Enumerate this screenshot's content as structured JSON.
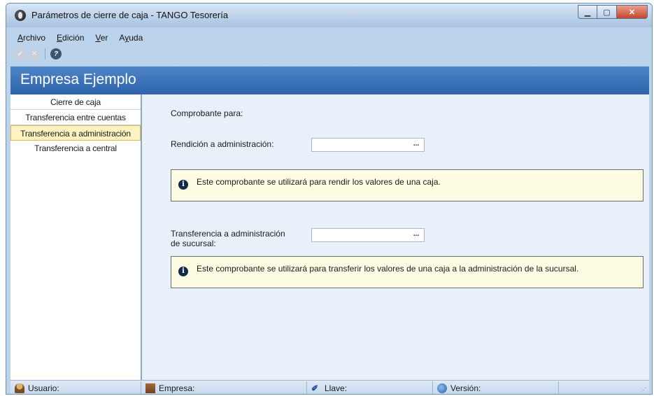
{
  "window": {
    "title": "Parámetros de cierre de caja - TANGO Tesorería"
  },
  "menu": [
    {
      "label": "Archivo",
      "u": "A",
      "rest": "rchivo"
    },
    {
      "label": "Edición",
      "u": "E",
      "rest": "dición"
    },
    {
      "label": "Ver",
      "u": "V",
      "rest": "er"
    },
    {
      "label": "Ayuda",
      "pre": "A",
      "u": "y",
      "rest": "uda"
    }
  ],
  "header": {
    "title": "Empresa Ejemplo"
  },
  "sidebar": {
    "items": [
      {
        "label": "Cierre de caja"
      },
      {
        "label": "Transferencia entre cuentas"
      },
      {
        "label": "Transferencia a administración",
        "active": true
      },
      {
        "label": "Transferencia a central"
      }
    ]
  },
  "form": {
    "section_label": "Comprobante para:",
    "rendicion_label": "Rendición a administración:",
    "rendicion_value": "",
    "rendicion_button": "...",
    "rendicion_note": "Este comprobante se utilizará para rendir los valores de una caja.",
    "sucursal_label_line1": "Transferencia a administración",
    "sucursal_label_line2": "de sucursal:",
    "sucursal_value": "",
    "sucursal_button": "...",
    "sucursal_note": "Este comprobante se utilizará para transferir los valores de una caja a la administración de la sucursal.",
    "info_glyph": "i"
  },
  "statusbar": {
    "usuario": "Usuario:",
    "empresa": "Empresa:",
    "llave": "Llave:",
    "version": "Versión:"
  },
  "icons": {
    "ok": "check-circle-icon",
    "cancel": "cancel-circle-icon",
    "help": "help-icon"
  }
}
